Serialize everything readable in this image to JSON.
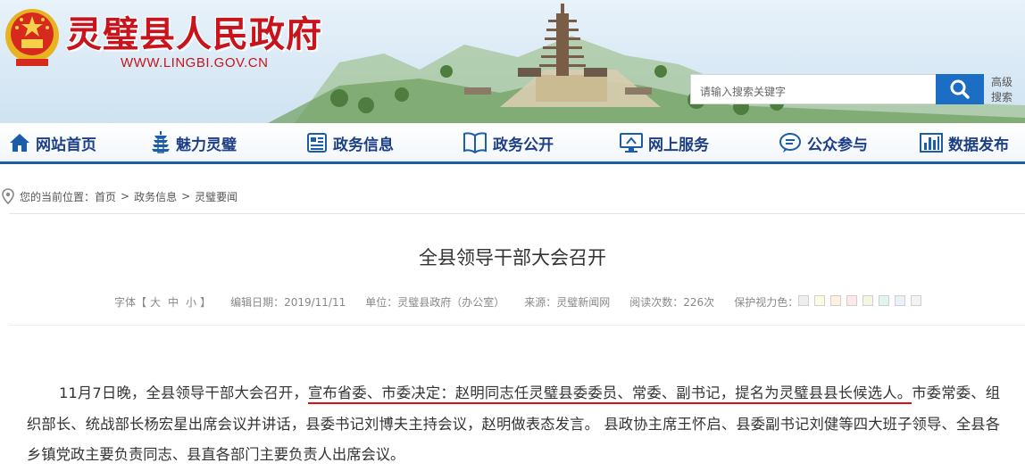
{
  "header": {
    "site_title": "灵璧县人民政府",
    "site_url": "WWW.LINGBI.GOV.CN",
    "search": {
      "placeholder": "请输入搜索关键字"
    },
    "advanced_search": "高级搜索",
    "colors": {
      "brand_red": "#c8141c",
      "accent_blue": "#1c6dc4"
    }
  },
  "nav": {
    "items": [
      {
        "label": "网站首页",
        "icon": "home-icon"
      },
      {
        "label": "魅力灵璧",
        "icon": "pagoda-icon"
      },
      {
        "label": "政务信息",
        "icon": "document-icon"
      },
      {
        "label": "政务公开",
        "icon": "open-book-icon"
      },
      {
        "label": "网上服务",
        "icon": "monitor-icon"
      },
      {
        "label": "公众参与",
        "icon": "chat-icon"
      },
      {
        "label": "数据发布",
        "icon": "bar-chart-icon"
      }
    ],
    "color": "#1d3f86"
  },
  "breadcrumb": {
    "prefix": "您的当前位置：",
    "items": [
      "首页",
      "政务信息",
      "灵璧要闻"
    ],
    "separator": ">"
  },
  "article": {
    "title": "全县领导干部大会召开",
    "meta": {
      "font_label": "字体【",
      "font_sizes": [
        "大",
        "中",
        "小"
      ],
      "font_close": "】",
      "date": "编辑日期：2019/11/11",
      "unit": "单位：灵璧县政府（办公室）",
      "source": "来源：灵璧新闻网",
      "views": "阅读次数：226次",
      "eye_label": "保护视力色：",
      "eye_colors": [
        "#eeeeee",
        "#fffbe0",
        "#fff1e0",
        "#fde9e9",
        "#f0f8e0",
        "#e0f5ee",
        "#eaf1f8",
        "#f3f3f3"
      ]
    },
    "body": {
      "part1": "11月7日晚，全县领导干部大会召开，",
      "highlight": "宣布省委、市委决定：赵明同志任灵璧县委委员、常委、副书记，提名为灵璧县县长候选人。",
      "part2": "市委常委、组织部长、统战部长杨宏星出席会议并讲话，县委书记刘博夫主持会议，赵明做表态发言。 县政协主席王怀启、县委副书记刘健等四大班子领导、全县各乡镇党政主要负责同志、县直各部门主要负责人出席会议。"
    },
    "highlight_color": "#e20b14"
  }
}
